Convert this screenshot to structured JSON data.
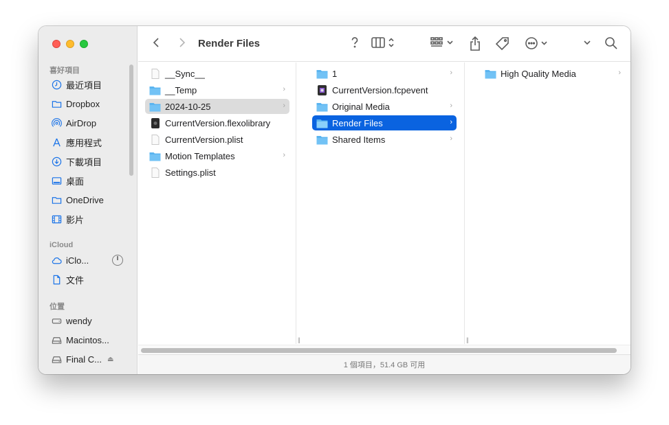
{
  "window": {
    "title": "Render Files"
  },
  "sidebar": {
    "sections": [
      {
        "label": "喜好項目"
      },
      {
        "label": "iCloud"
      },
      {
        "label": "位置"
      }
    ],
    "favorites": [
      {
        "label": "最近項目",
        "icon": "clock-icon"
      },
      {
        "label": "Dropbox",
        "icon": "folder-icon"
      },
      {
        "label": "AirDrop",
        "icon": "airdrop-icon"
      },
      {
        "label": "應用程式",
        "icon": "applications-icon"
      },
      {
        "label": "下載項目",
        "icon": "download-icon"
      },
      {
        "label": "桌面",
        "icon": "desktop-icon"
      },
      {
        "label": "OneDrive",
        "icon": "folder-icon"
      },
      {
        "label": "影片",
        "icon": "film-icon"
      }
    ],
    "icloud": [
      {
        "label": "iClo...",
        "icon": "cloud-icon"
      },
      {
        "label": "文件",
        "icon": "document-icon"
      }
    ],
    "locations": [
      {
        "label": "wendy",
        "icon": "drive-icon"
      },
      {
        "label": "Macintos...",
        "icon": "drive-icon"
      },
      {
        "label": "Final C...",
        "icon": "drive-icon"
      }
    ]
  },
  "columns": {
    "col1": [
      {
        "name": "__Sync__",
        "kind": "file"
      },
      {
        "name": "__Temp",
        "kind": "folder"
      },
      {
        "name": "2024-10-25",
        "kind": "folder"
      },
      {
        "name": "CurrentVersion.flexolibrary",
        "kind": "library"
      },
      {
        "name": "CurrentVersion.plist",
        "kind": "file"
      },
      {
        "name": "Motion Templates",
        "kind": "folder"
      },
      {
        "name": "Settings.plist",
        "kind": "file"
      }
    ],
    "col2": [
      {
        "name": "1",
        "kind": "folder"
      },
      {
        "name": "CurrentVersion.fcpevent",
        "kind": "event"
      },
      {
        "name": "Original Media",
        "kind": "folder"
      },
      {
        "name": "Render Files",
        "kind": "folder"
      },
      {
        "name": "Shared Items",
        "kind": "folder"
      }
    ],
    "col3": [
      {
        "name": "High Quality Media",
        "kind": "folder"
      }
    ]
  },
  "status": {
    "text": "1 個項目，51.4 GB 可用"
  },
  "colors": {
    "selection_blue": "#0a63e0",
    "selection_gray": "#dcdcdc",
    "folder_blue": "#5ab4f0"
  }
}
